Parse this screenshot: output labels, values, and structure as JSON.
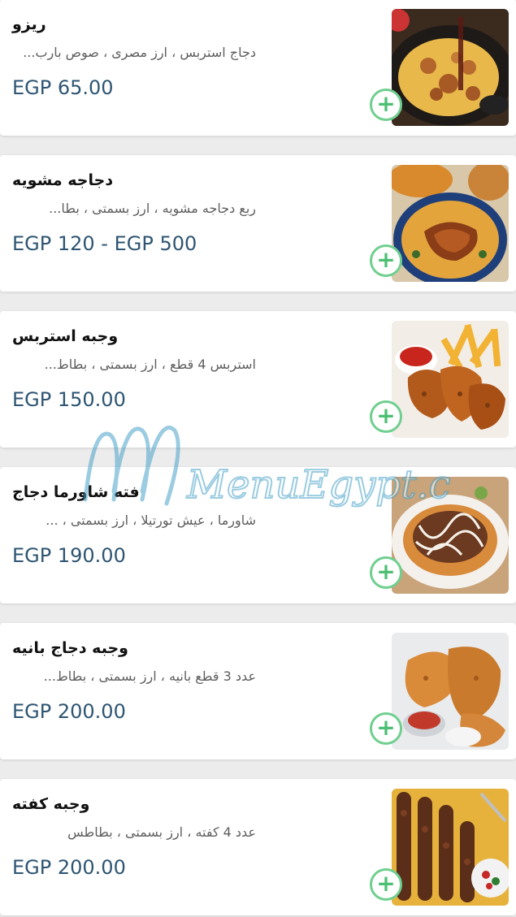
{
  "menu": {
    "currency_color": "#2e5572",
    "add_button_color": "#4cbf73",
    "items": [
      {
        "name": "ريزو",
        "description": "دجاج استربس ، ارز مصرى ، صوص بارب...",
        "price": "EGP 65.00",
        "image_icon": "rice-chicken-plate-icon",
        "add_label": "+"
      },
      {
        "name": "دجاجه مشويه",
        "description": "ربع دجاجه مشويه ، ارز بسمتى ، بطا...",
        "price": "EGP 120 - EGP 500",
        "image_icon": "grilled-chicken-plate-icon",
        "add_label": "+"
      },
      {
        "name": "وجبه استربس",
        "description": "استربس 4 قطع ، ارز بسمتى ، بطاط...",
        "price": "EGP 150.00",
        "image_icon": "chicken-strips-fries-icon",
        "add_label": "+"
      },
      {
        "name": "فته شاورما دجاج",
        "description": "شاورما ، عيش تورتيلا ، ارز بسمتى ، ...",
        "price": "EGP 190.00",
        "image_icon": "shawarma-fatta-plate-icon",
        "add_label": "+"
      },
      {
        "name": "وجبه دجاج بانيه",
        "description": "عدد 3 قطع بانيه ، ارز بسمتى ، بطاط...",
        "price": "EGP 200.00",
        "image_icon": "breaded-chicken-plate-icon",
        "add_label": "+"
      },
      {
        "name": "وجبه كفته",
        "description": "عدد 4 كفته ، ارز بسمتى ، بطاطس",
        "price": "EGP 200.00",
        "image_icon": "kofta-skewers-plate-icon",
        "add_label": "+"
      }
    ]
  },
  "watermark": {
    "text": "MenuEgypt.com",
    "color": "#4aa3c9"
  }
}
